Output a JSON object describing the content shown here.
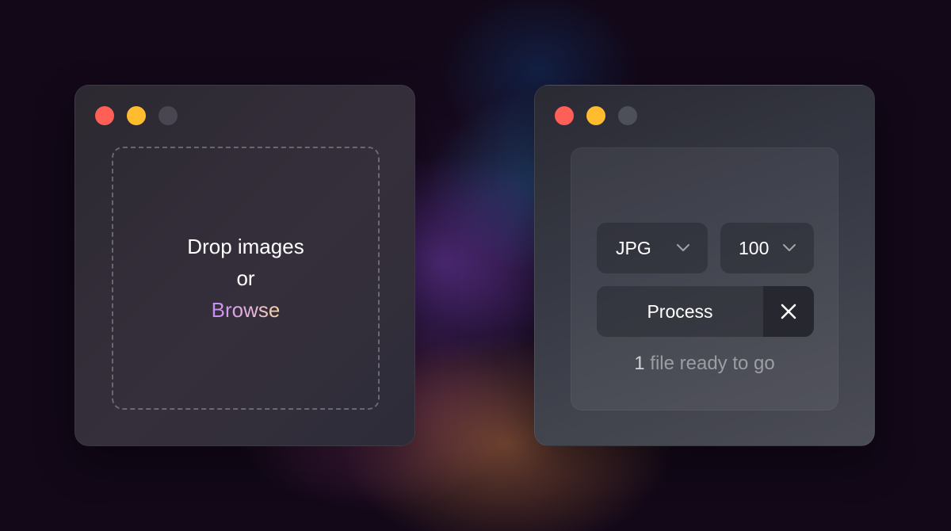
{
  "background": {
    "base_color": "#120818"
  },
  "left_window": {
    "traffic_lights": {
      "close_color": "#fe5f57",
      "minimize_color": "#febc2e",
      "maximize_color": "#4a4651"
    },
    "dropzone": {
      "line1": "Drop images",
      "line2": "or",
      "browse_label": "Browse"
    }
  },
  "right_window": {
    "traffic_lights": {
      "close_color": "#fe5f57",
      "minimize_color": "#febc2e",
      "maximize_color": "#4e5059"
    },
    "format_select": {
      "value": "JPG",
      "icon": "chevron-down-icon"
    },
    "quality_select": {
      "value": "100",
      "icon": "chevron-down-icon"
    },
    "process_button": {
      "label": "Process"
    },
    "clear_button": {
      "icon": "close-icon"
    },
    "status": {
      "count": "1",
      "text": " file ready to go"
    }
  }
}
